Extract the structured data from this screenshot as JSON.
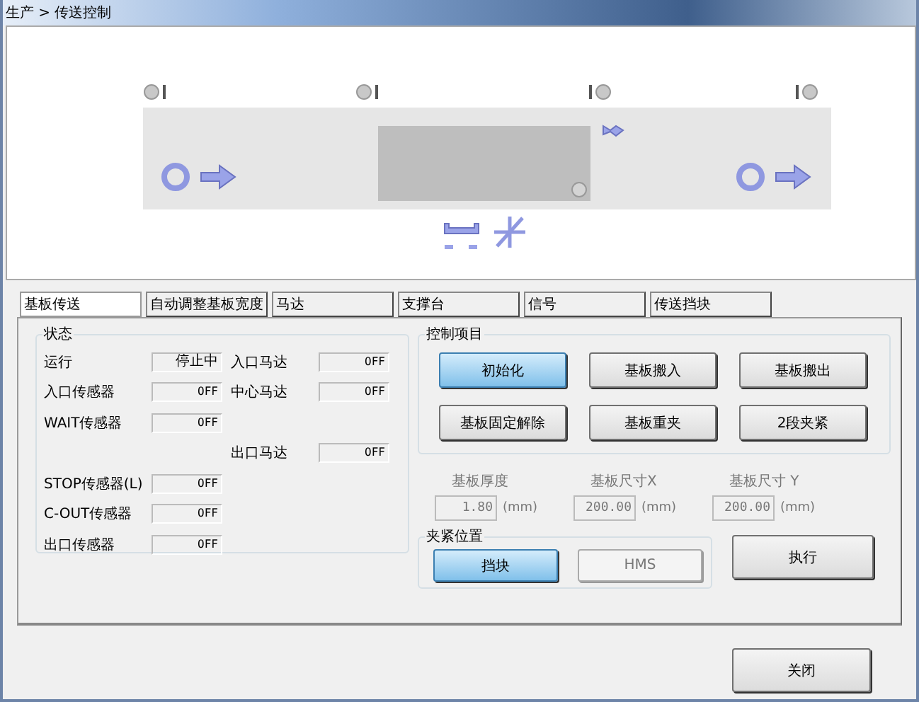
{
  "title": "生产 > 传送控制",
  "tabs": [
    {
      "label": "基板传送",
      "selected": true
    },
    {
      "label": "自动调整基板宽度",
      "selected": false
    },
    {
      "label": "马达",
      "selected": false
    },
    {
      "label": "支撑台",
      "selected": false
    },
    {
      "label": "信号",
      "selected": false
    },
    {
      "label": "传送挡块",
      "selected": false
    }
  ],
  "status": {
    "title": "状态",
    "rows": [
      {
        "sensor": {
          "label": "运行",
          "value": "停止中"
        },
        "motor": {
          "label": "入口马达",
          "value": "OFF"
        }
      },
      {
        "sensor": {
          "label": "入口传感器",
          "value": "OFF"
        },
        "motor": {
          "label": "中心马达",
          "value": "OFF"
        }
      },
      {
        "sensor": {
          "label": "WAIT传感器",
          "value": "OFF"
        }
      },
      {
        "motor": {
          "label": "出口马达",
          "value": "OFF"
        }
      },
      {
        "sensor": {
          "label": "STOP传感器(L)",
          "value": "OFF"
        }
      },
      {
        "sensor": {
          "label": "C-OUT传感器",
          "value": "OFF"
        }
      },
      {
        "sensor": {
          "label": "出口传感器",
          "value": "OFF"
        }
      }
    ]
  },
  "control": {
    "title": "控制项目",
    "buttons": [
      {
        "label": "初始化",
        "selected": true
      },
      {
        "label": "基板搬入",
        "selected": false
      },
      {
        "label": "基板搬出",
        "selected": false
      },
      {
        "label": "基板固定解除",
        "selected": false
      },
      {
        "label": "基板重夹",
        "selected": false
      },
      {
        "label": "2段夹紧",
        "selected": false
      }
    ]
  },
  "params": [
    {
      "label": "基板厚度",
      "value": "1.80",
      "unit": "(mm)",
      "disabled": true
    },
    {
      "label": "基板尺寸X",
      "value": "200.00",
      "unit": "(mm)",
      "disabled": true
    },
    {
      "label": "基板尺寸 Y",
      "value": "200.00",
      "unit": "(mm)",
      "disabled": true
    }
  ],
  "clamp": {
    "title": "夹紧位置",
    "options": [
      {
        "label": "挡块",
        "selected": true,
        "disabled": false
      },
      {
        "label": "HMS",
        "selected": false,
        "disabled": true
      }
    ]
  },
  "execute": "执行",
  "close": "关闭"
}
